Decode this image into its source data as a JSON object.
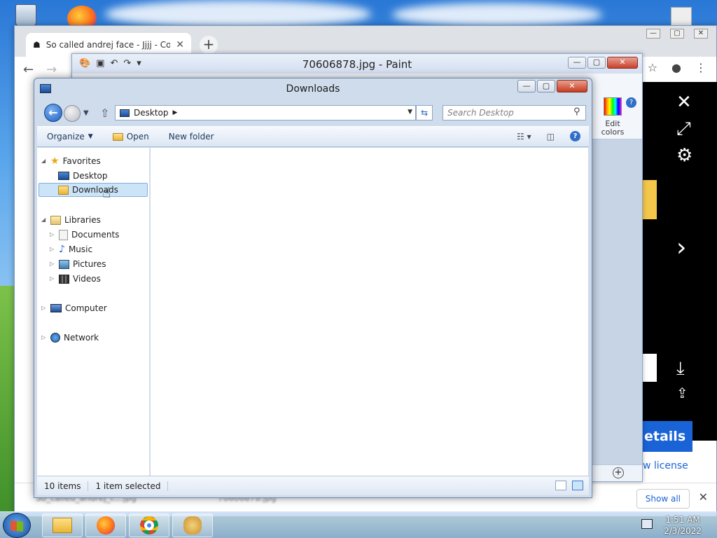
{
  "chrome": {
    "tab_title": "So called andrej face - Jjjj - Comp",
    "tab_close": "✕",
    "new_tab": "+",
    "details_label": "etails",
    "license_label": "w license",
    "show_all": "Show all",
    "downloads_close": "✕",
    "blurred_file1": "So_called_andrej_f....jpg",
    "blurred_file2": "70606878.jpg"
  },
  "paint": {
    "title": "70606878.jpg - Paint",
    "edit_colors": "Edit colors",
    "palette_colors": [
      "#000000",
      "#7f7f7f",
      "#880015",
      "#ed1c24",
      "#ff7f27",
      "#fff200",
      "#22b14c",
      "#00a2e8",
      "#3f48cc",
      "#a349a4",
      "#ffffff",
      "#c3c3c3",
      "#b97a57",
      "#ffaec9",
      "#ffc90e",
      "#efe4b0",
      "#b5e61d",
      "#99d9ea",
      "#7092be",
      "#c8bfe7"
    ]
  },
  "explorer": {
    "title": "Downloads",
    "address": "Desktop",
    "search_placeholder": "Search Desktop",
    "commands": {
      "organize": "Organize",
      "open": "Open",
      "new_folder": "New folder"
    },
    "nav": {
      "favorites": "Favorites",
      "desktop": "Desktop",
      "downloads": "Downloads",
      "libraries": "Libraries",
      "documents": "Documents",
      "music": "Music",
      "pictures": "Pictures",
      "videos": "Videos",
      "computer": "Computer",
      "network": "Network"
    },
    "status": {
      "items": "10 items",
      "selected": "1 item selected"
    }
  },
  "taskbar": {
    "time": "1:51 AM",
    "date": "2/3/2022"
  },
  "colors": {
    "accent": "#1a63d6",
    "selection": "#cce4f7"
  }
}
